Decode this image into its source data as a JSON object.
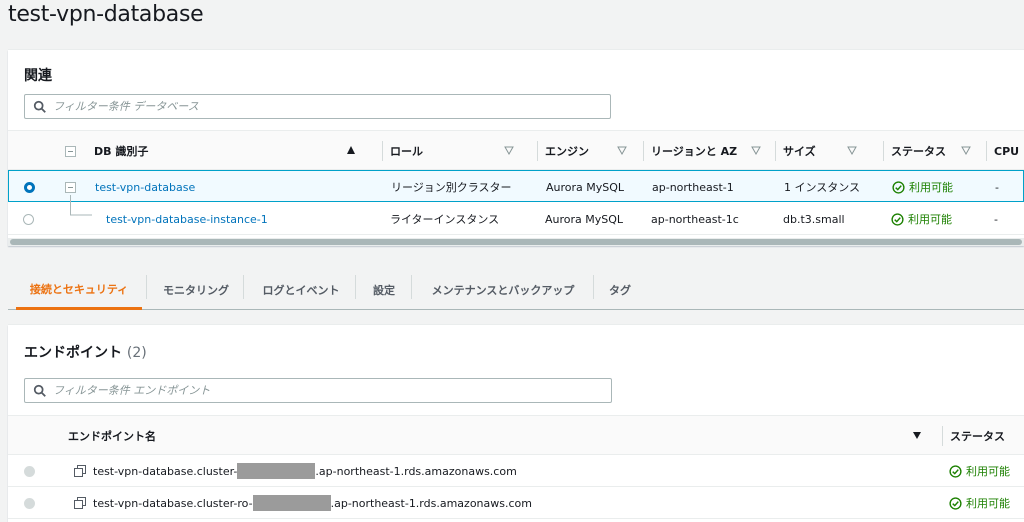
{
  "page": {
    "title": "test-vpn-database"
  },
  "related": {
    "heading": "関連",
    "filter_placeholder": "フィルター条件 データベース",
    "columns": [
      "DB 識別子",
      "ロール",
      "エンジン",
      "リージョンと AZ",
      "サイズ",
      "ステータス",
      "CPU"
    ],
    "rows": [
      {
        "id": "test-vpn-database",
        "role": "リージョン別クラスター",
        "engine": "Aurora MySQL",
        "region": "ap-northeast-1",
        "size": "1 インスタンス",
        "status": "利用可能",
        "cpu": "-",
        "selected": true
      },
      {
        "id": "test-vpn-database-instance-1",
        "role": "ライターインスタンス",
        "engine": "Aurora MySQL",
        "region": "ap-northeast-1c",
        "size": "db.t3.small",
        "status": "利用可能",
        "cpu": "-",
        "selected": false
      }
    ]
  },
  "tabs": [
    "接続とセキュリティ",
    "モニタリング",
    "ログとイベント",
    "設定",
    "メンテナンスとバックアップ",
    "タグ"
  ],
  "endpoints": {
    "heading": "エンドポイント",
    "count": "(2)",
    "filter_placeholder": "フィルター条件 エンドポイント",
    "columns": [
      "エンドポイント名",
      "ステータス"
    ],
    "rows": [
      {
        "name_prefix": "test-vpn-database.cluster-",
        "name_suffix": ".ap-northeast-1.rds.amazonaws.com",
        "status": "利用可能"
      },
      {
        "name_prefix": "test-vpn-database.cluster-ro-",
        "name_suffix": ".ap-northeast-1.rds.amazonaws.com",
        "status": "利用可能"
      }
    ]
  },
  "colors": {
    "link": "#0073bb",
    "accent": "#ec7211",
    "success": "#1d8102",
    "selected_border": "#00a1c9"
  },
  "icons": [
    "search-icon",
    "sort-asc-icon",
    "sort-desc-icon",
    "check-circle-icon",
    "copy-icon",
    "expand-collapse-icon"
  ]
}
